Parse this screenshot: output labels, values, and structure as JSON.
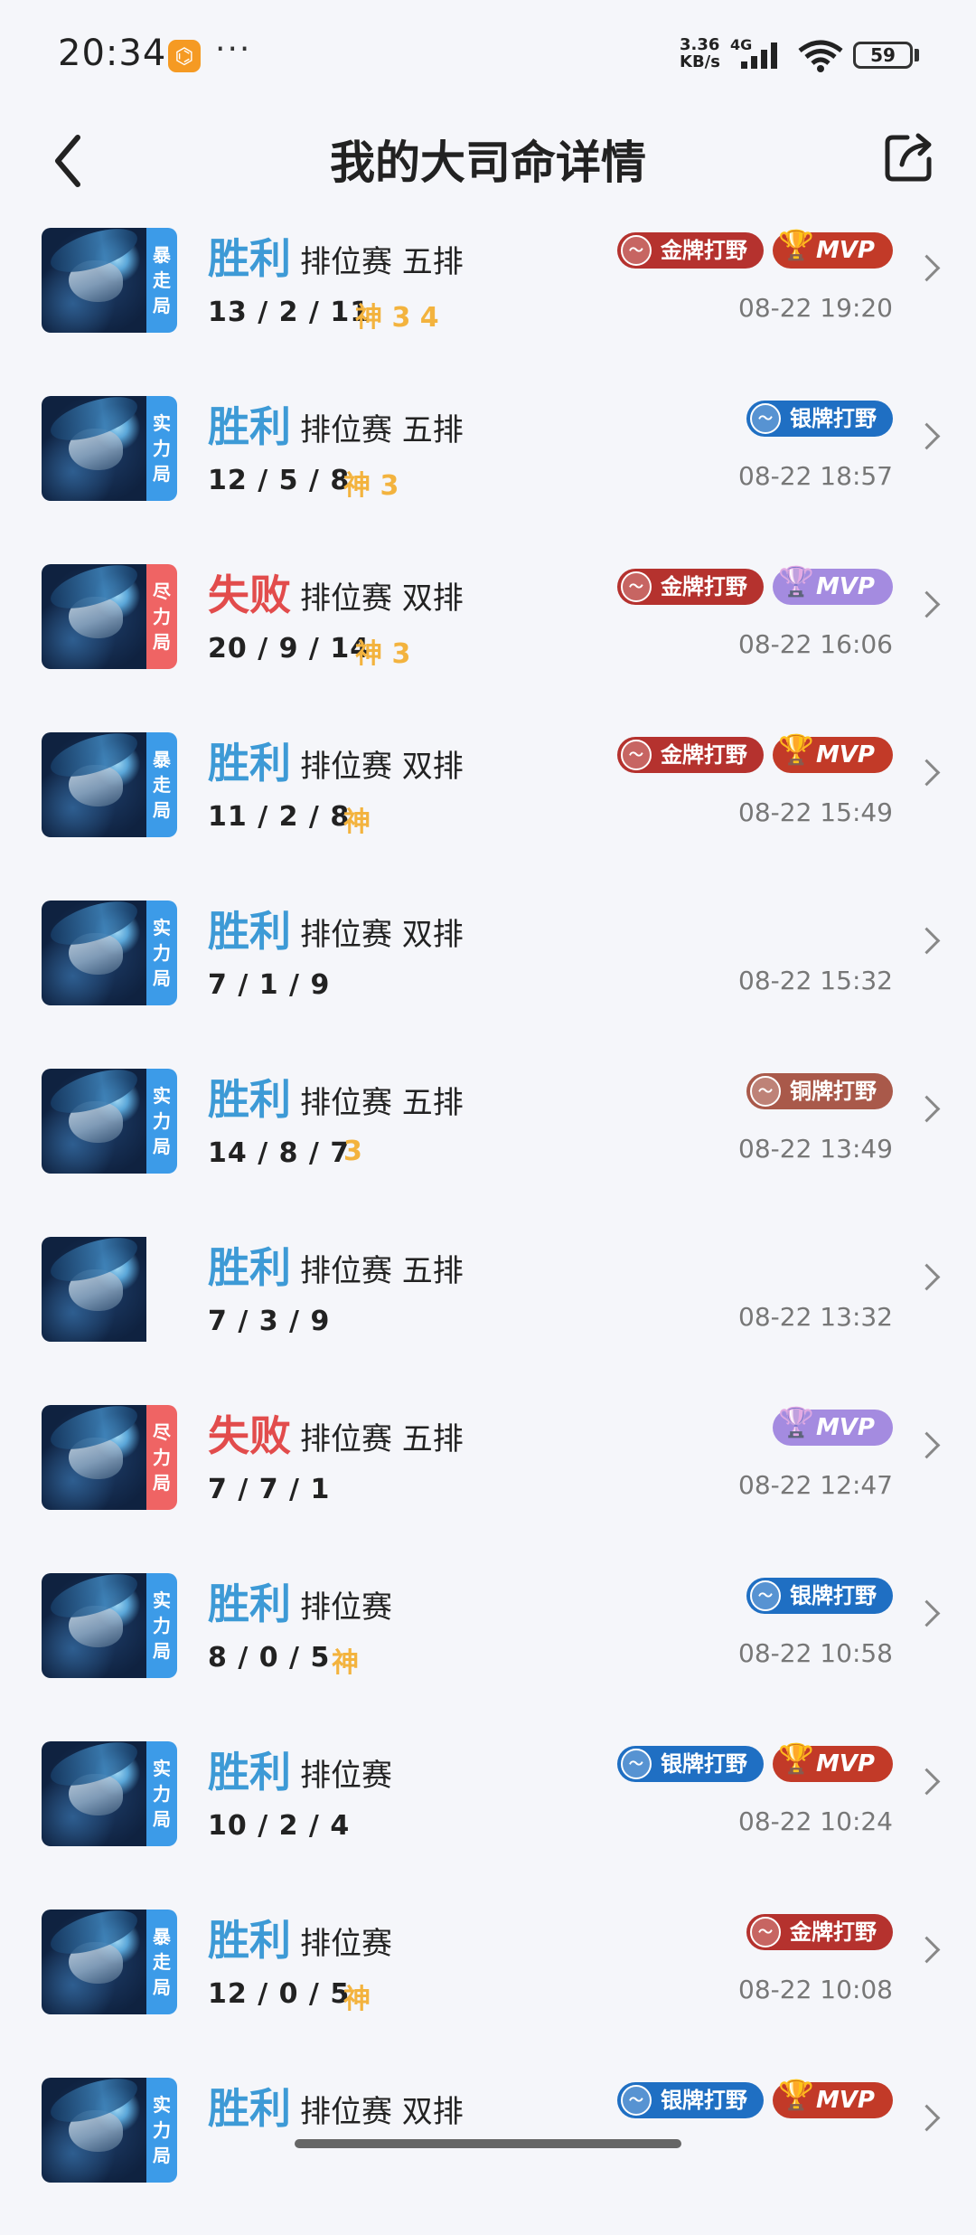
{
  "status": {
    "time": "20:34",
    "app_icon": "ox-app-icon",
    "dots": "···",
    "net_speed_value": "3.36",
    "net_speed_unit": "KB/s",
    "network": "4G",
    "wifi_strength": "6",
    "battery": "59"
  },
  "header": {
    "title": "我的大司命详情"
  },
  "colors": {
    "win": "#3d9ad6",
    "loss": "#e24c4c",
    "god": "#f3b33e",
    "gold_badge": "#b5322e",
    "silver_badge": "#1f6fc3",
    "bronze_badge": "#a9594a",
    "mvp_gold": "#c23a28",
    "mvp_purple": "#a48be0"
  },
  "matches": [
    {
      "tag": [
        "暴",
        "走",
        "局"
      ],
      "tag_color": "blue",
      "result": "胜利",
      "win": true,
      "mode": "排位赛 五排",
      "kda": "13 / 2 / 11",
      "god": "神 3 4",
      "jungle": "金牌打野",
      "jungle_tier": "gold",
      "mvp": "MVP",
      "mvp_tier": "gold",
      "time": "08-22 19:20"
    },
    {
      "tag": [
        "实",
        "力",
        "局"
      ],
      "tag_color": "blue",
      "result": "胜利",
      "win": true,
      "mode": "排位赛 五排",
      "kda": "12 / 5 / 8",
      "god": "神 3",
      "jungle": "银牌打野",
      "jungle_tier": "silver",
      "mvp": "",
      "mvp_tier": "",
      "time": "08-22 18:57"
    },
    {
      "tag": [
        "尽",
        "力",
        "局"
      ],
      "tag_color": "red",
      "result": "失败",
      "win": false,
      "mode": "排位赛 双排",
      "kda": "20 / 9 / 14",
      "god": "神 3",
      "jungle": "金牌打野",
      "jungle_tier": "gold",
      "mvp": "MVP",
      "mvp_tier": "purple",
      "time": "08-22 16:06"
    },
    {
      "tag": [
        "暴",
        "走",
        "局"
      ],
      "tag_color": "blue",
      "result": "胜利",
      "win": true,
      "mode": "排位赛 双排",
      "kda": "11 / 2 / 8",
      "god": "神",
      "jungle": "金牌打野",
      "jungle_tier": "gold",
      "mvp": "MVP",
      "mvp_tier": "gold",
      "time": "08-22 15:49"
    },
    {
      "tag": [
        "实",
        "力",
        "局"
      ],
      "tag_color": "blue",
      "result": "胜利",
      "win": true,
      "mode": "排位赛 双排",
      "kda": "7 / 1 / 9",
      "god": "",
      "jungle": "",
      "jungle_tier": "",
      "mvp": "",
      "mvp_tier": "",
      "time": "08-22 15:32"
    },
    {
      "tag": [
        "实",
        "力",
        "局"
      ],
      "tag_color": "blue",
      "result": "胜利",
      "win": true,
      "mode": "排位赛 五排",
      "kda": "14 / 8 / 7",
      "god": "3",
      "jungle": "铜牌打野",
      "jungle_tier": "bronze",
      "mvp": "",
      "mvp_tier": "",
      "time": "08-22 13:49"
    },
    {
      "tag": [],
      "tag_color": "none",
      "result": "胜利",
      "win": true,
      "mode": "排位赛 五排",
      "kda": "7 / 3 / 9",
      "god": "",
      "jungle": "",
      "jungle_tier": "",
      "mvp": "",
      "mvp_tier": "",
      "time": "08-22 13:32"
    },
    {
      "tag": [
        "尽",
        "力",
        "局"
      ],
      "tag_color": "red",
      "result": "失败",
      "win": false,
      "mode": "排位赛 五排",
      "kda": "7 / 7 / 1",
      "god": "",
      "jungle": "",
      "jungle_tier": "",
      "mvp": "MVP",
      "mvp_tier": "purple",
      "time": "08-22 12:47"
    },
    {
      "tag": [
        "实",
        "力",
        "局"
      ],
      "tag_color": "blue",
      "result": "胜利",
      "win": true,
      "mode": "排位赛",
      "kda": "8 / 0 / 5",
      "god": "神",
      "jungle": "银牌打野",
      "jungle_tier": "silver",
      "mvp": "",
      "mvp_tier": "",
      "time": "08-22 10:58"
    },
    {
      "tag": [
        "实",
        "力",
        "局"
      ],
      "tag_color": "blue",
      "result": "胜利",
      "win": true,
      "mode": "排位赛",
      "kda": "10 / 2 / 4",
      "god": "",
      "jungle": "银牌打野",
      "jungle_tier": "silver",
      "mvp": "MVP",
      "mvp_tier": "gold",
      "time": "08-22 10:24"
    },
    {
      "tag": [
        "暴",
        "走",
        "局"
      ],
      "tag_color": "blue",
      "result": "胜利",
      "win": true,
      "mode": "排位赛",
      "kda": "12 / 0 / 5",
      "god": "神",
      "jungle": "金牌打野",
      "jungle_tier": "gold",
      "mvp": "",
      "mvp_tier": "",
      "time": "08-22 10:08"
    },
    {
      "tag": [
        "实",
        "力",
        "局"
      ],
      "tag_color": "blue",
      "result": "胜利",
      "win": true,
      "mode": "排位赛 双排",
      "kda": "",
      "god": "",
      "jungle": "银牌打野",
      "jungle_tier": "silver",
      "mvp": "MVP",
      "mvp_tier": "gold",
      "time": ""
    }
  ]
}
